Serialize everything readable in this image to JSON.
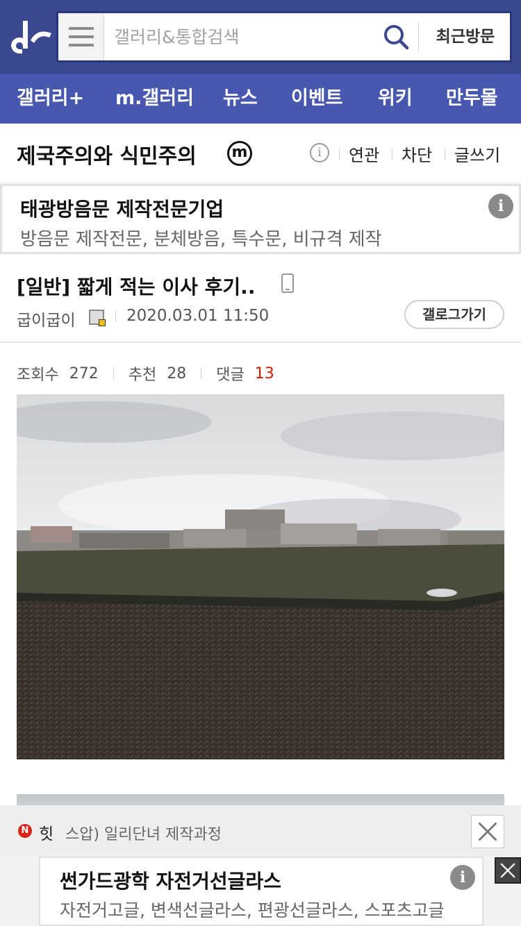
{
  "header": {
    "search_placeholder": "갤러리&통합검색",
    "recent_label": "최근방문"
  },
  "nav": {
    "items": [
      {
        "label": "갤러리+"
      },
      {
        "label": "m.갤러리"
      },
      {
        "label": "뉴스"
      },
      {
        "label": "이벤트"
      },
      {
        "label": "위키"
      },
      {
        "label": "만두몰"
      }
    ]
  },
  "gallery": {
    "title": "제국주의와 식민주의",
    "badge": "m",
    "info_glyph": "i",
    "links": [
      "연관",
      "차단",
      "글쓰기"
    ]
  },
  "ad_top": {
    "title": "태광방음문 제작전문기업",
    "description": "방음문 제작전문, 분체방음, 특수문, 비규격 제작",
    "info_glyph": "i"
  },
  "post": {
    "title": "[일반] 짧게 적는 이사 후기..",
    "author": "굽이굽이",
    "date": "2020.03.01 11:50",
    "gallery_button": "갤로그가기",
    "stats": {
      "views_label": "조회수",
      "views": "272",
      "recommend_label": "추천",
      "recommend": "28",
      "comments_label": "댓글",
      "comments": "13"
    }
  },
  "notice": {
    "badge": "N",
    "label": "힛",
    "text": "스압) 일리단녀 제작과정"
  },
  "ad_bottom": {
    "title": "썬가드광학 자전거선글라스",
    "description": "자전거고글, 변색선글라스, 편광선글라스, 스포츠고글",
    "info_glyph": "i"
  },
  "colors": {
    "header_bg": "#3b4890",
    "nav_bg": "#4758ae",
    "comment_count": "#d31900",
    "notice_badge": "#d72519"
  },
  "icons": {
    "logo": "dc-logo",
    "menu": "hamburger-icon",
    "search": "search-icon",
    "info": "info-icon",
    "mobile": "mobile-icon",
    "close": "close-icon"
  }
}
